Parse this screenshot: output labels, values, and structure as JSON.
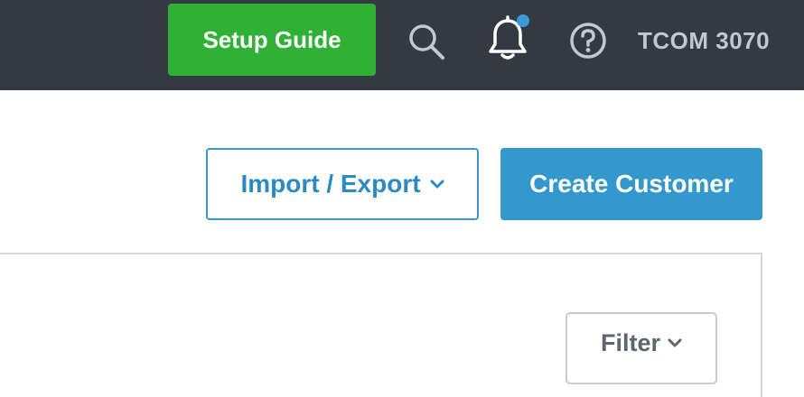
{
  "header": {
    "setup_guide_label": "Setup Guide",
    "account_name": "TCOM 3070",
    "icons": {
      "search": "search-icon",
      "notifications": "bell-icon",
      "help": "help-circle-icon"
    },
    "notification_badge": true
  },
  "toolbar": {
    "import_export_label": "Import / Export",
    "create_customer_label": "Create Customer"
  },
  "panel": {
    "filter_label": "Filter"
  },
  "colors": {
    "topbar": "#343a42",
    "setup_green": "#2eb135",
    "primary_blue": "#3498cc",
    "badge_blue": "#3a9bd5"
  }
}
